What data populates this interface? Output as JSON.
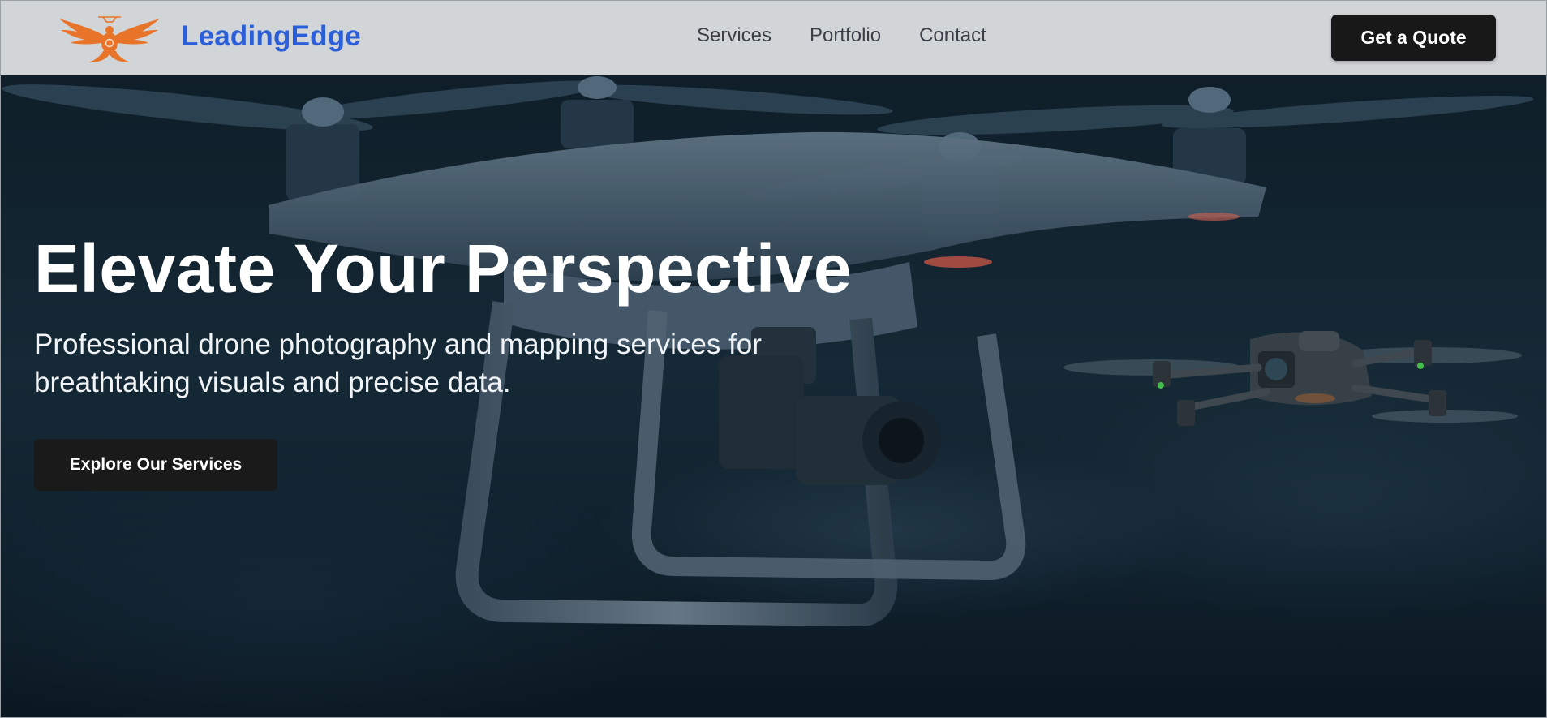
{
  "brand": {
    "name": "LeadingEdge",
    "logo_icon": "eagle-logo-icon",
    "logo_color": "#e8742a",
    "name_color": "#2b5fd9"
  },
  "nav": {
    "links": [
      "Services",
      "Portfolio",
      "Contact"
    ],
    "cta_label": "Get a Quote"
  },
  "hero": {
    "title": "Elevate Your Perspective",
    "subtitle": "Professional drone photography and mapping services for breathtaking visuals and precise data.",
    "cta_label": "Explore Our Services",
    "background_image": "drone-hero-image"
  }
}
